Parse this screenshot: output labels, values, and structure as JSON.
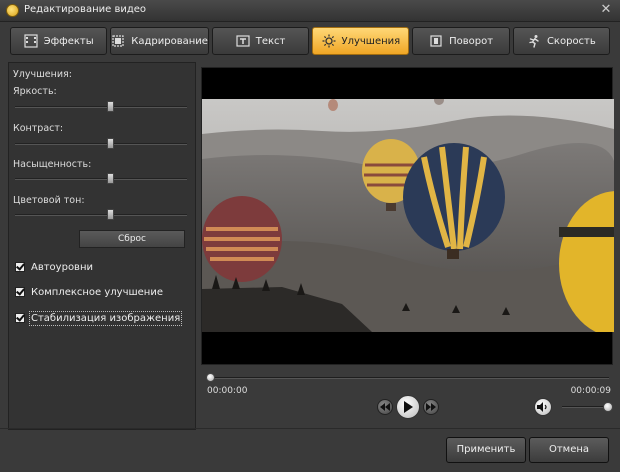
{
  "window": {
    "title": "Редактирование видео"
  },
  "tabs": [
    {
      "label": "Эффекты",
      "icon": "film-effects-icon",
      "active": false
    },
    {
      "label": "Кадрирование",
      "icon": "crop-frame-icon",
      "active": false
    },
    {
      "label": "Текст",
      "icon": "text-t-icon",
      "active": false
    },
    {
      "label": "Улучшения",
      "icon": "sun-brightness-icon",
      "active": true
    },
    {
      "label": "Поворот",
      "icon": "rotate-icon",
      "active": false
    },
    {
      "label": "Скорость",
      "icon": "runner-speed-icon",
      "active": false
    }
  ],
  "enhancements": {
    "heading": "Улучшения:",
    "sliders": [
      {
        "label": "Яркость:",
        "value": 0.55
      },
      {
        "label": "Контраст:",
        "value": 0.55
      },
      {
        "label": "Насыщенность:",
        "value": 0.55
      },
      {
        "label": "Цветовой тон:",
        "value": 0.55
      }
    ],
    "reset_label": "Сброс",
    "checkboxes": [
      {
        "label": "Автоуровни",
        "checked": true
      },
      {
        "label": "Комплексное улучшение",
        "checked": true
      },
      {
        "label": "Стабилизация изображения",
        "checked": true
      }
    ]
  },
  "player": {
    "time_current": "00:00:00",
    "time_total": "00:00:09",
    "progress": 0.0,
    "volume": 1.0
  },
  "buttons": {
    "apply": "Применить",
    "cancel": "Отмена"
  },
  "colors": {
    "active_tab": "#f0a625",
    "background": "#3a3a3a"
  }
}
